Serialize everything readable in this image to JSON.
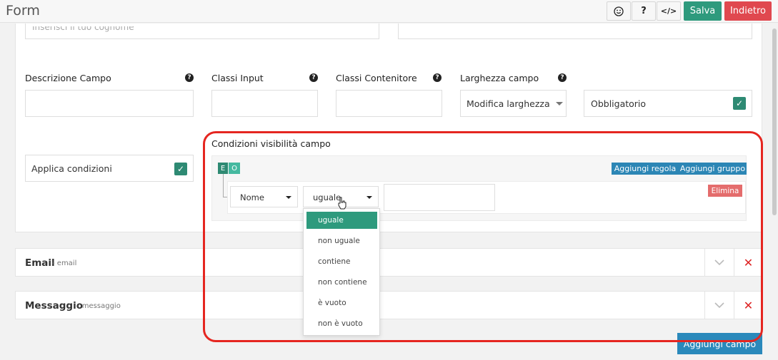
{
  "header": {
    "title": "Form",
    "buttons": {
      "emoji_icon": "smiley-icon",
      "help_label": "?",
      "code_label": "</>",
      "save_label": "Salva",
      "back_label": "Indietro"
    }
  },
  "colors": {
    "save": "#2e9a7d",
    "back": "#e0484f",
    "primary_blue": "#2c86b5",
    "delete_red": "#e46c6c",
    "highlight_red": "#e52620"
  },
  "form": {
    "partial_placeholder": "Inserisci il tuo cognome",
    "fields": {
      "descrizione_label": "Descrizione Campo",
      "classi_input_label": "Classi Input",
      "classi_contenitore_label": "Classi Contenitore",
      "larghezza_label": "Larghezza campo",
      "larghezza_value": "Modifica larghezza",
      "obbligatorio_label": "Obbligatorio",
      "applica_label": "Applica condizioni"
    },
    "conditions": {
      "title": "Condizioni visibilità campo",
      "and_label": "E",
      "or_label": "O",
      "add_rule": "Aggiungi regola",
      "add_group": "Aggiungi gruppo",
      "rule": {
        "field": "Nome",
        "operator": "uguale",
        "value": "",
        "delete": "Elimina"
      },
      "operator_options": [
        "uguale",
        "non uguale",
        "contiene",
        "non contiene",
        "è vuoto",
        "non è vuoto"
      ],
      "selected_operator": "uguale"
    }
  },
  "accordion": [
    {
      "title": "Email",
      "subtitle": "- email"
    },
    {
      "title": "Messaggio",
      "subtitle": "- messaggio"
    }
  ],
  "footer": {
    "add_field": "Aggiungi campo"
  }
}
